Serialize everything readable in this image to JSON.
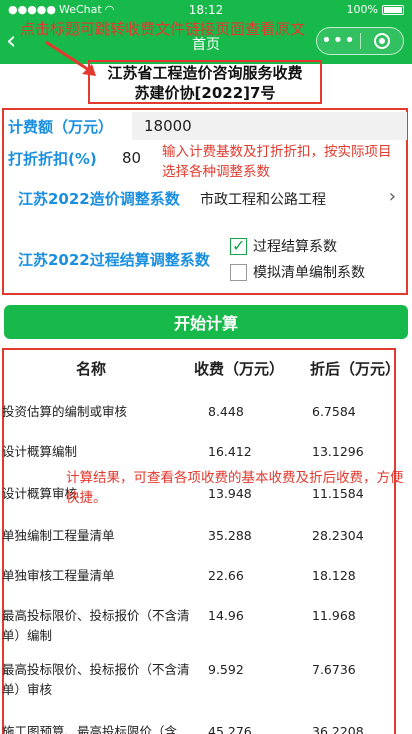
{
  "status": {
    "carrier": "WeChat",
    "time": "18:12",
    "battery": "100%"
  },
  "nav": {
    "title": "首页",
    "overlay_hint": "点击标题可跳转收费文件链接页面查看原文"
  },
  "doc_title": {
    "line1": "江苏省工程造价咨询服务收费",
    "line2": "苏建价协[2022]7号"
  },
  "form": {
    "base_label": "计费额（万元）",
    "base_value": "18000",
    "discount_label": "打折折扣(%)",
    "discount_value": "80",
    "input_hint": "输入计费基数及打折折扣，按实际项目选择各种调整系数",
    "adjust_label": "江苏2022造价调整系数",
    "adjust_value": "市政工程和公路工程",
    "process_label": "江苏2022过程结算调整系数",
    "checkbox1": "过程结算系数",
    "checkbox2": "模拟清单编制系数"
  },
  "button": {
    "calc": "开始计算"
  },
  "table": {
    "headers": [
      "名称",
      "收费（万元）",
      "折后（万元）"
    ],
    "rows": [
      {
        "name": "投资估算的编制或审核",
        "fee": "8.448",
        "disc": "6.7584"
      },
      {
        "name": "设计概算编制",
        "fee": "16.412",
        "disc": "13.1296"
      },
      {
        "name": "设计概算审核",
        "fee": "13.948",
        "disc": "11.1584"
      },
      {
        "name": "单独编制工程量清单",
        "fee": "35.288",
        "disc": "28.2304"
      },
      {
        "name": "单独审核工程量清单",
        "fee": "22.66",
        "disc": "18.128"
      },
      {
        "name": "最高投标限价、投标报价（不含清单）编制",
        "fee": "14.96",
        "disc": "11.968"
      },
      {
        "name": "最高投标限价、投标报价（不含清单）审核",
        "fee": "9.592",
        "disc": "7.6736"
      },
      {
        "name": "施工图预算、最高投标限价（含",
        "fee": "45.276",
        "disc": "36.2208"
      }
    ],
    "result_hint": "计算结果，可查看各项收费的基本收费及折后收费，方便快捷。"
  },
  "colors": {
    "brand": "#16b94a",
    "accent_blue": "#1a8fe0",
    "annotation_red": "#e23a2e"
  }
}
